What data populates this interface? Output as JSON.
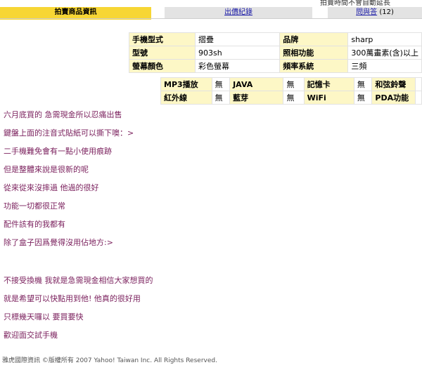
{
  "header": {
    "top_note": "拍賣時間不會自動延長"
  },
  "tabs": [
    {
      "label": "拍賣商品資訊",
      "active": true
    },
    {
      "label": "出價紀錄",
      "active": false
    },
    {
      "label": "問與答",
      "count": "(12)",
      "active": false
    }
  ],
  "spec_table_1": {
    "rows": [
      {
        "l1": "手機型式",
        "v1": "摺疊",
        "l2": "品牌",
        "v2": "sharp"
      },
      {
        "l1": "型號",
        "v1": "903sh",
        "l2": "照相功能",
        "v2": "300萬畫素(含)以上"
      },
      {
        "l1": "螢幕顏色",
        "v1": "彩色螢幕",
        "l2": "頻率系統",
        "v2": "三頻"
      }
    ]
  },
  "spec_table_2": {
    "rows": [
      {
        "l1": "MP3播放",
        "v1": "無",
        "l2": "JAVA",
        "v2": "無",
        "l3": "記憶卡",
        "v3": "無",
        "l4": "和弦鈴聲",
        "v4": ""
      },
      {
        "l1": "紅外線",
        "v1": "無",
        "l2": "藍芽",
        "v2": "無",
        "l3": "WiFi",
        "v3": "無",
        "l4": "PDA功能",
        "v4": ""
      }
    ]
  },
  "description": {
    "lines_1": [
      "六月底買的 急需現金所以忍痛出售",
      "鍵盤上面的注音式貼紙可以撕下噢：>",
      "二手機難免會有一點小使用痕跡",
      "但是整體來說是很新的呢",
      "從來從來沒摔過 他過的很好",
      "功能一切都很正常",
      "配件該有的我都有",
      "除了盒子因爲覺得沒用佔地方:>"
    ],
    "lines_2": [
      "不接受換機 我就是急需現金相信大家想買的",
      "就是希望可以快點用到他! 他真的很好用",
      "只標幾天囉以 要買要快",
      "歡迎面交試手機"
    ]
  },
  "footer": {
    "text": "雅虎國際資訊 ©版權所有 2007 Yahoo! Taiwan Inc. All Rights Reserved."
  },
  "colors": {
    "active_tab": "#f7d634",
    "inactive_tab": "#e3e3e3",
    "label_cell": "#fdf7c6",
    "description_text": "#7a1f5c",
    "link": "#1a1aa6"
  }
}
